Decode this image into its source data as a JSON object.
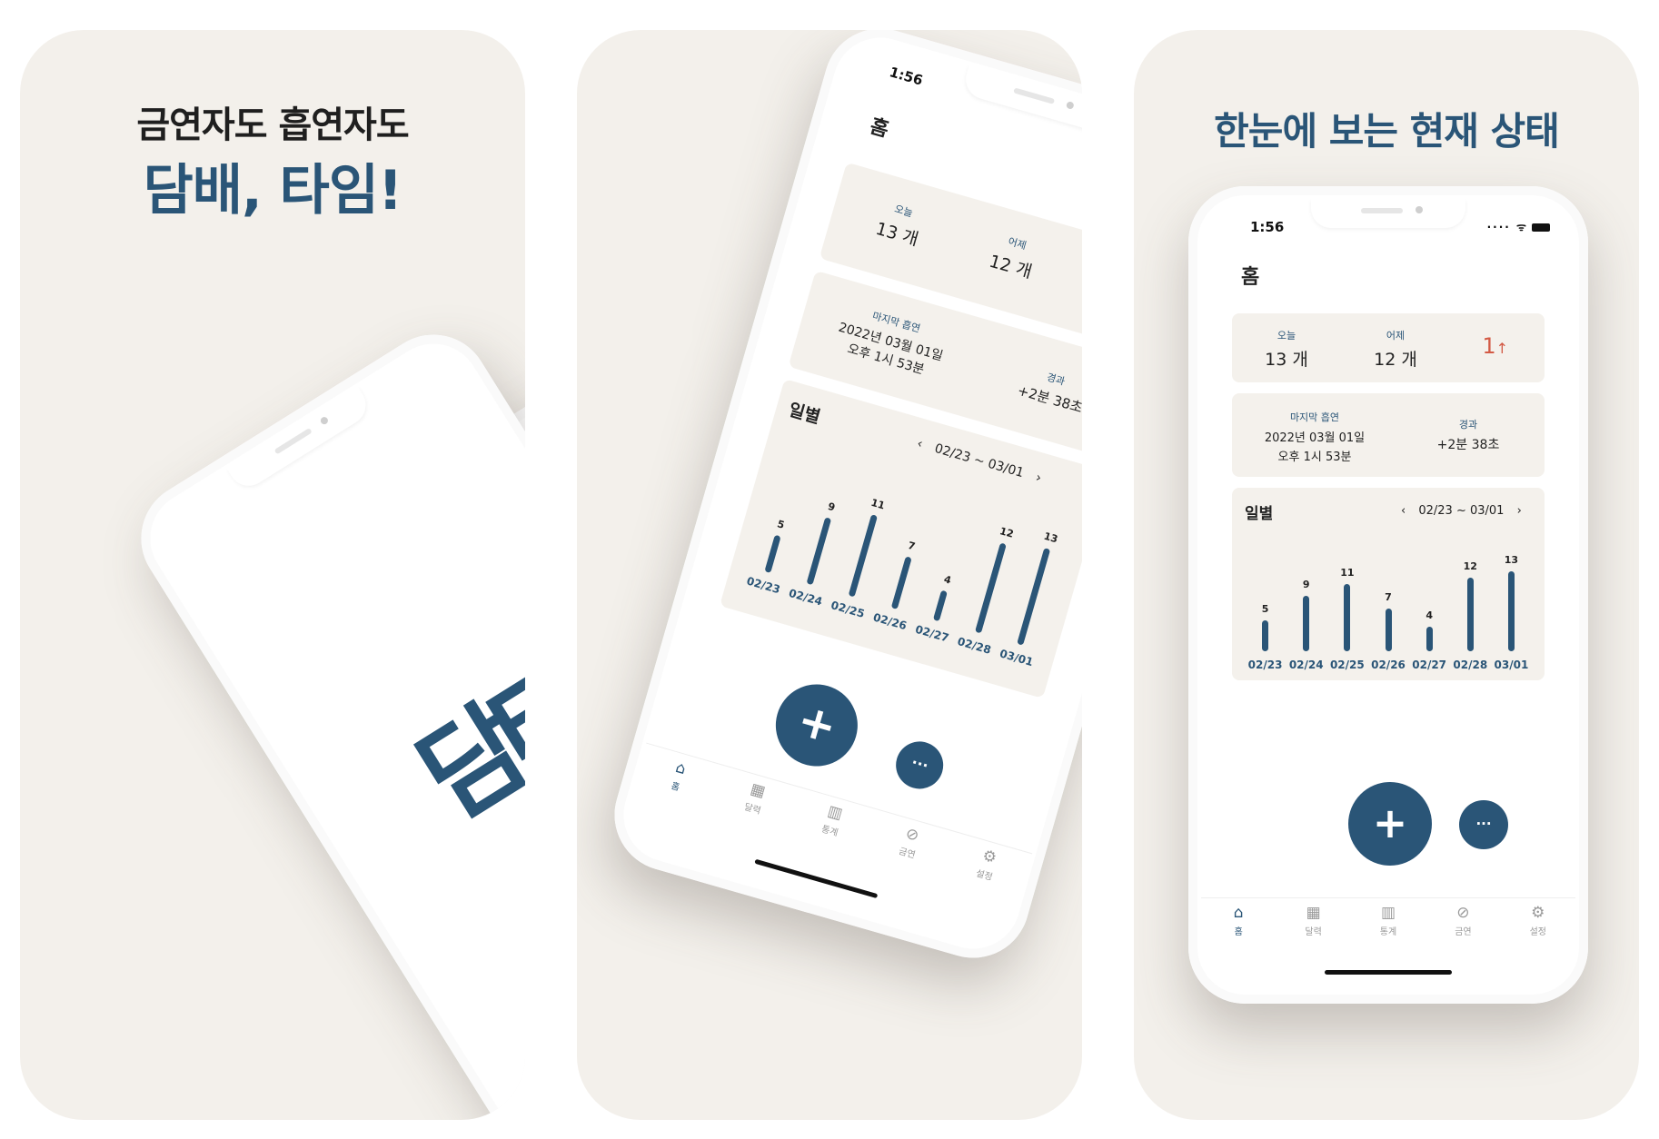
{
  "panel1": {
    "caption_line1": "금연자도 흡연자도",
    "caption_line2": "담배, 타임!",
    "splash_logo": "담타",
    "peek_tab_label": "홈"
  },
  "panel3": {
    "caption": "한눈에 보는 현재 상태"
  },
  "app": {
    "status_time": "1:56",
    "status_icons": "···· ᯤ",
    "title": "홈",
    "today_label": "오늘",
    "today_value": "13 개",
    "yesterday_label": "어제",
    "yesterday_value": "12 개",
    "diff_value": "1",
    "diff_arrow": "↑",
    "last_smoke_label": "마지막 흡연",
    "last_smoke_date": "2022년 03월 01일",
    "last_smoke_time": "오후 1시 53분",
    "elapsed_label": "경과",
    "elapsed_value": "+2분 38초",
    "daily_title": "일별",
    "range_prev": "‹",
    "range_text": "02/23 ~ 03/01",
    "range_next": "›",
    "fab_add": "+",
    "fab_more": "···",
    "tabs": [
      {
        "label": "홈",
        "icon": "home-icon",
        "glyph": "⌂"
      },
      {
        "label": "달력",
        "icon": "calendar-icon",
        "glyph": "▦"
      },
      {
        "label": "통계",
        "icon": "stats-icon",
        "glyph": "▥"
      },
      {
        "label": "금연",
        "icon": "no-smoking-icon",
        "glyph": "⊘"
      },
      {
        "label": "설정",
        "icon": "gear-icon",
        "glyph": "⚙"
      }
    ]
  },
  "chart_data": {
    "type": "bar",
    "categories": [
      "02/23",
      "02/24",
      "02/25",
      "02/26",
      "02/27",
      "02/28",
      "03/01"
    ],
    "values": [
      5,
      9,
      11,
      7,
      4,
      12,
      13
    ],
    "title": "일별",
    "xlabel": "",
    "ylabel": "",
    "grid": false
  },
  "colors": {
    "brand": "#2a5577",
    "panel_bg": "#f3f0eb",
    "card_bg": "#f4f1ec",
    "increase": "#d35a45"
  }
}
